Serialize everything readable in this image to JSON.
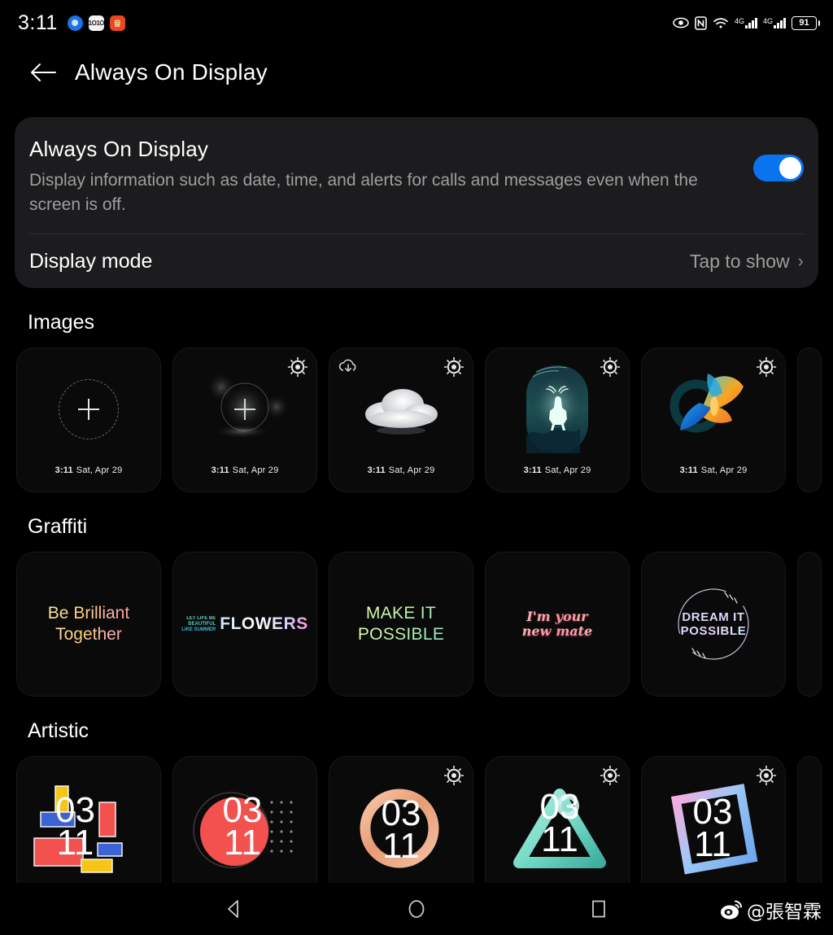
{
  "status_bar": {
    "clock": "3:11",
    "left_icons": [
      {
        "name": "app-icon-blue",
        "glyph": ""
      },
      {
        "name": "app-icon-white",
        "glyph": "1O1O"
      },
      {
        "name": "app-icon-orange",
        "glyph": "音"
      }
    ],
    "right_icons": [
      "eye-comfort-icon",
      "nfc-icon",
      "wifi-icon",
      "signal-4g-icon",
      "signal-4g-plus-icon"
    ],
    "signal_1_label": "4G",
    "signal_2_label": "4G",
    "signal_2_sup": "+",
    "battery_percent": "91"
  },
  "app_bar": {
    "back_icon": "back-arrow-icon",
    "title": "Always On Display"
  },
  "panel": {
    "title": "Always On Display",
    "subtitle": "Display information such as date, time, and alerts for calls and messages even when the screen is off.",
    "toggle_on": true,
    "mode_label": "Display mode",
    "mode_value": "Tap to show",
    "chevron": "›"
  },
  "sections": [
    {
      "id": "images",
      "title": "Images",
      "tiles": [
        {
          "name": "add-image-tile",
          "kind": "add",
          "time": "3:11",
          "date": "Sat, Apr 29",
          "gear": false,
          "download": false
        },
        {
          "name": "image-tile-bokeh",
          "kind": "add-bokeh",
          "time": "3:11",
          "date": "Sat, Apr 29",
          "gear": true,
          "download": false
        },
        {
          "name": "image-tile-cloud",
          "kind": "cloud",
          "time": "3:11",
          "date": "Sat, Apr 29",
          "gear": true,
          "download": true
        },
        {
          "name": "image-tile-deer",
          "kind": "deer",
          "time": "3:11",
          "date": "Sat, Apr 29",
          "gear": true,
          "download": false
        },
        {
          "name": "image-tile-butterfly",
          "kind": "butterfly",
          "time": "3:11",
          "date": "Sat, Apr 29",
          "gear": true,
          "download": false
        },
        {
          "name": "image-tile-next-partial",
          "kind": "partial",
          "time": "",
          "date": "",
          "gear": false,
          "download": false
        }
      ]
    },
    {
      "id": "graffiti",
      "title": "Graffiti",
      "tiles": [
        {
          "name": "graffiti-tile-be-brilliant",
          "kind": "text1",
          "line1": "Be Brilliant",
          "line2": "Together"
        },
        {
          "name": "graffiti-tile-flowers",
          "kind": "flowers",
          "small1": "LET LIFE BE",
          "small2": "BEAUTIFUL",
          "small3": "LIKE SUMMER",
          "big": "FLOWERS"
        },
        {
          "name": "graffiti-tile-make-it-possible",
          "kind": "text3",
          "line1": "MAKE IT",
          "line2": "POSSIBLE"
        },
        {
          "name": "graffiti-tile-new-mate",
          "kind": "text4",
          "line1a": "I'm",
          "line1b": "your",
          "line2a": "new",
          "line2b": "mate"
        },
        {
          "name": "graffiti-tile-dream-it-possible",
          "kind": "wreath",
          "line1": "DREAM IT",
          "line2": "POSSIBLE"
        },
        {
          "name": "graffiti-tile-next-partial",
          "kind": "partial"
        }
      ]
    },
    {
      "id": "artistic",
      "title": "Artistic",
      "tiles": [
        {
          "name": "artistic-tile-mondrian",
          "kind": "mondrian",
          "hh": "03",
          "mm": "11",
          "gear": false
        },
        {
          "name": "artistic-tile-red-circle",
          "kind": "circle-dots",
          "hh": "03",
          "mm": "11",
          "gear": false
        },
        {
          "name": "artistic-tile-copper-ring",
          "kind": "ring",
          "hh": "03",
          "mm": "11",
          "gear": true
        },
        {
          "name": "artistic-tile-triangle",
          "kind": "triangle",
          "hh": "03",
          "mm": "11",
          "gear": true
        },
        {
          "name": "artistic-tile-square-frame",
          "kind": "frame",
          "hh": "03",
          "mm": "11",
          "gear": true
        },
        {
          "name": "artistic-tile-next-partial",
          "kind": "partial",
          "hh": "",
          "mm": "",
          "gear": false
        }
      ]
    }
  ],
  "nav_bar": {
    "back": "nav-back-icon",
    "home": "nav-home-icon",
    "recents": "nav-recents-icon"
  },
  "watermark": {
    "logo": "weibo-logo-icon",
    "handle": "@張智霖"
  },
  "colors": {
    "accent_blue": "#0a74f0",
    "panel_bg": "#1c1c1e",
    "tile_bg": "#0a0a0a",
    "muted_text": "#9e9e9e"
  }
}
